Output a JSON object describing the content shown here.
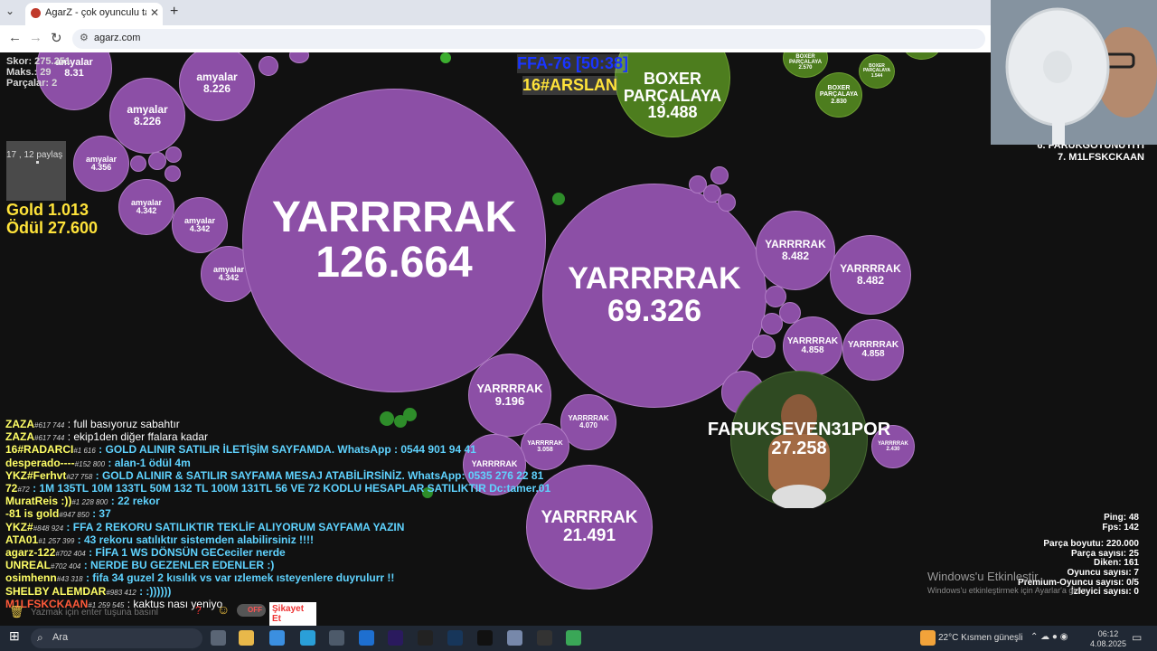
{
  "browser": {
    "tab_title": "AgarZ - çok oyunculu tarayıcı o",
    "url": "agarz.com"
  },
  "hud": {
    "score": "Skor: 275.251",
    "max": "Maks.: 29",
    "parts": "Parçalar: 2",
    "share": "17 , 12 paylaş",
    "gold": "Gold 1.013",
    "reward": "Ödül 27.600",
    "ffa": "FFA-76 [50:38]",
    "rank": "16#ARSLAN"
  },
  "leaderboard": {
    "line6": "6. FARUKGOTUNUYIYI",
    "line7": "7. M1LFSKCKAAN"
  },
  "cells": {
    "main1_name": "YARRRRAK",
    "main1_mass": "126.664",
    "main2_name": "YARRRRAK",
    "main2_mass": "69.326",
    "c3_name": "YARRRRAK",
    "c3_mass": "9.196",
    "c4_name": "YARRRRAK",
    "c4_mass": "21.491",
    "c5_name": "YARRRRAK",
    "c5_mass": "8.482",
    "c6_name": "YARRRRAK",
    "c6_mass": "8.482",
    "c7_name": "YARRRRAK",
    "c7_mass": "4.858",
    "c8_name": "YARRRRAK",
    "c8_mass": "4.858",
    "c9_name": "YARRRRAK",
    "c9_mass": "4.070",
    "c10_name": "YARRRRAK",
    "c10_mass": "3.058",
    "c11_name": "YARRRRAK",
    "c11_mass": "2.430",
    "c12_name": "YARRRRAK",
    "faruk_name": "FARUKSEVEN31POR",
    "faruk_mass": "27.258",
    "boxer_name": "BOXER PARÇALAYA",
    "boxer_mass": "19.488",
    "boxer2_name": "BOXER PARÇALAYA",
    "boxer2_mass": "2.830",
    "boxer3_name": "BOXER PARÇALAYA",
    "boxer3_mass": "1.544",
    "boxer4_name": "BOXER PARÇALAYA",
    "boxer4_mass": "2.570",
    "am_name": "amyalar",
    "am1_mass": "8.226",
    "am2_mass": "8.226",
    "am3_mass": "4.356",
    "am4_mass": "4.342",
    "am5_mass": "4.342",
    "am6_mass": "4.342",
    "am7_mass": "8.31"
  },
  "chat": [
    {
      "name": "ZAZA",
      "tag": "#617 744",
      "msg": ": full basıyoruz sabahtır",
      "color": "#ffff66",
      "msgcolor": "#ffffff"
    },
    {
      "name": "ZAZA",
      "tag": "#617 744",
      "msg": ": ekip1den diğer ffalara kadar",
      "color": "#ffff66",
      "msgcolor": "#ffffff"
    },
    {
      "name": "16#RADARCI",
      "tag": "#1 616",
      "msg": ": GOLD ALINIR SATILIR İLETİŞİM SAYFAMDA. WhatsApp : 0544 901 94 41",
      "color": "#ffff66",
      "msgcolor": "#5fd3ff"
    },
    {
      "name": "desperado----",
      "tag": "#152 800",
      "msg": ": alan-1 ödül 4m",
      "color": "#ffff66",
      "msgcolor": "#5fd3ff"
    },
    {
      "name": "YKZ#Ferhvt",
      "tag": "#27 758",
      "msg": ": GOLD ALINIR & SATILIR SAYFAMA MESAJ ATABİLİRSİNİZ. WhatsApp: 0535 276 22 81",
      "color": "#ffff66",
      "msgcolor": "#5fd3ff"
    },
    {
      "name": "72",
      "tag": "#72",
      "msg": ": 1M 135TL 10M 133TL 50M 132 TL 100M 131TL 56 VE 72 KODLU HESAPLAR SATILIKTIR Dc:tamer.01",
      "color": "#ffff66",
      "msgcolor": "#5fd3ff"
    },
    {
      "name": "MuratReis :))",
      "tag": "#1 228 800",
      "msg": ": 22 rekor",
      "color": "#ffff66",
      "msgcolor": "#5fd3ff"
    },
    {
      "name": "-81 is gold",
      "tag": "#947 850",
      "msg": ": 37",
      "color": "#ffff66",
      "msgcolor": "#5fd3ff"
    },
    {
      "name": "YKZ#",
      "tag": "#848 924",
      "msg": ": FFA 2 REKORU SATILIKTIR TEKLİF ALIYORUM SAYFAMA YAZIN",
      "color": "#ffff66",
      "msgcolor": "#5fd3ff"
    },
    {
      "name": "ATA01",
      "tag": "#1 257 399",
      "msg": ": 43 rekoru satılıktır sistemden alabilirsiniz !!!!",
      "color": "#ffff66",
      "msgcolor": "#5fd3ff"
    },
    {
      "name": "agarz-122",
      "tag": "#702 404",
      "msg": ": FİFA 1 WS DÖNSÜN GECeciler nerde",
      "color": "#ffff66",
      "msgcolor": "#5fd3ff"
    },
    {
      "name": "UNREAL",
      "tag": "#702 404",
      "msg": ": NERDE BU GEZENLER EDENLER :)",
      "color": "#ffff66",
      "msgcolor": "#5fd3ff"
    },
    {
      "name": "osimhenn",
      "tag": "#43 318",
      "msg": ": fifa 34 guzel 2 kısılık vs var ızlemek ısteyenlere duyrulurr !!",
      "color": "#ffff66",
      "msgcolor": "#5fd3ff"
    },
    {
      "name": "SHELBY ALEMDAR",
      "tag": "#983 412",
      "msg": ": :))))))",
      "color": "#ffff66",
      "msgcolor": "#5fd3ff"
    },
    {
      "name": "M1LFSKCKAAN",
      "tag": "#1 259 545",
      "msg": ": kaktus nası yeniyo",
      "color": "#ff5a3a",
      "msgcolor": "#ffffff"
    }
  ],
  "chatbar": {
    "placeholder": "Yazmak için enter tuşuna basınl",
    "toggle": "OFF",
    "report": "Şikayet Et"
  },
  "stats": {
    "ping": "Ping: 48",
    "fps": "Fps: 142",
    "part_size": "Parça boyutu: 220.000",
    "part_count": "Parça sayısı: 25",
    "spikes": "Diken: 161",
    "players": "Oyuncu sayısı: 7",
    "premium": "Premium-Oyuncu sayısı: 0/5",
    "viewers": "İzleyici sayısı: 0"
  },
  "windows": {
    "activate": "Windows'u Etkinleştir",
    "activate_sub": "Windows'u etkinleştirmek için Ayarlar'a gidin.",
    "search": "Ara",
    "weather": "22°C  Kısmen güneşli",
    "time": "06:12",
    "date": "4.08.2025"
  },
  "colors": {
    "cell_purple": "#8c4fa6",
    "cell_green": "#4d7d1e",
    "gold_text": "#ffe33a",
    "ffa_blue": "#1a35ff"
  }
}
